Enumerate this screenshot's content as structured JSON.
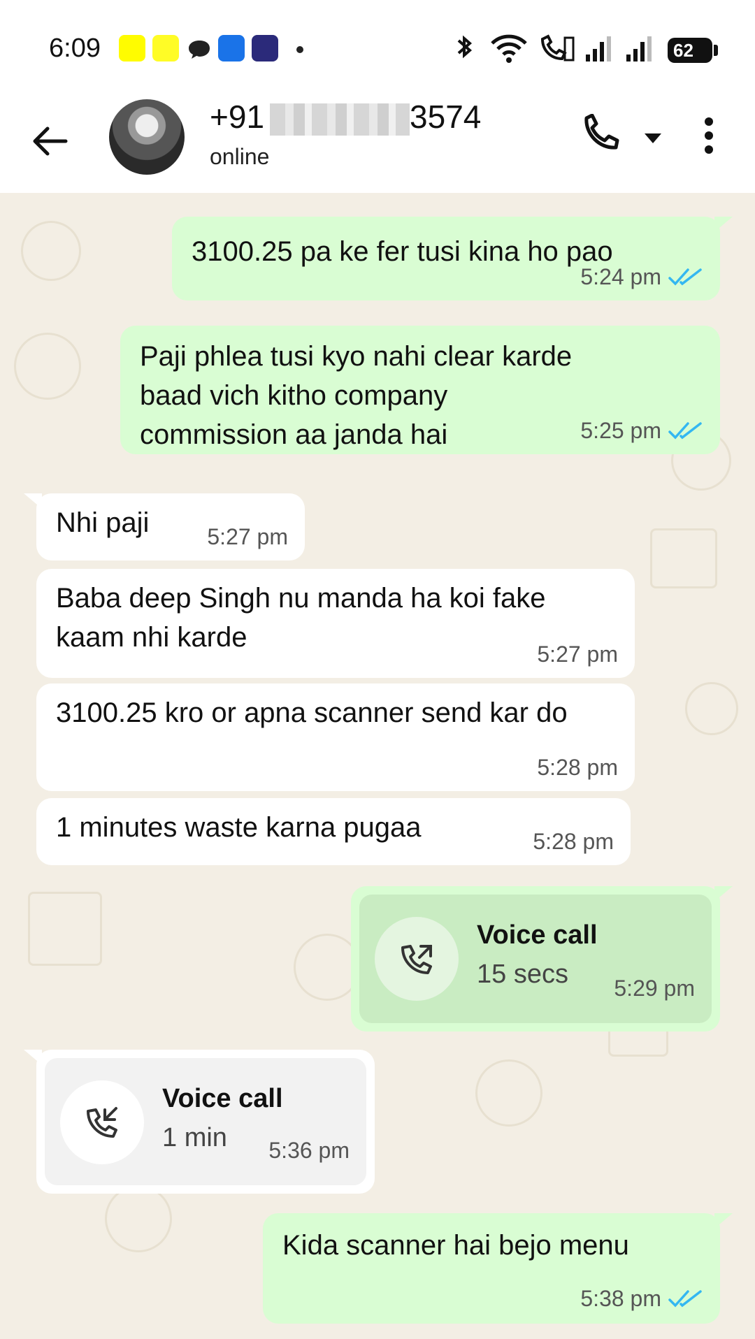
{
  "status_bar": {
    "time": "6:09",
    "battery": "62",
    "icons": [
      "snapchat-icon",
      "snapchat-icon",
      "chat-bubble-icon",
      "phone-app-icon",
      "jar-app-icon",
      "dot-icon",
      "bluetooth-icon",
      "wifi-icon",
      "volte-call-icon",
      "signal-icon",
      "signal-icon",
      "battery-icon"
    ]
  },
  "header": {
    "name_prefix": "+91",
    "name_suffix": "3574",
    "status": "online"
  },
  "colors": {
    "outgoing_bubble": "#d9fdd3",
    "incoming_bubble": "#ffffff",
    "chat_background": "#f3eee4",
    "read_ticks": "#34b7f1"
  },
  "messages": [
    {
      "dir": "out",
      "text": "3100.25 pa ke fer tusi kina ho pao",
      "time": "5:24 pm",
      "read": true
    },
    {
      "dir": "out",
      "text": "Paji phlea tusi kyo nahi clear karde baad vich kitho company commission aa janda hai",
      "time": "5:25 pm",
      "read": true
    },
    {
      "dir": "in",
      "text": "Nhi paji",
      "time": "5:27 pm"
    },
    {
      "dir": "in",
      "text": "Baba deep Singh nu manda ha koi fake kaam nhi karde",
      "time": "5:27 pm"
    },
    {
      "dir": "in",
      "text": "3100.25 kro or apna scanner send kar do",
      "time": "5:28 pm"
    },
    {
      "dir": "in",
      "text": "1 minutes waste karna pugaa",
      "time": "5:28 pm"
    },
    {
      "dir": "out",
      "type": "call",
      "title": "Voice call",
      "duration": "15 secs",
      "time": "5:29 pm"
    },
    {
      "dir": "in",
      "type": "call",
      "title": "Voice call",
      "duration": "1 min",
      "time": "5:36 pm"
    },
    {
      "dir": "out",
      "text": "Kida scanner hai bejo menu",
      "time": "5:38 pm",
      "read": true
    }
  ]
}
